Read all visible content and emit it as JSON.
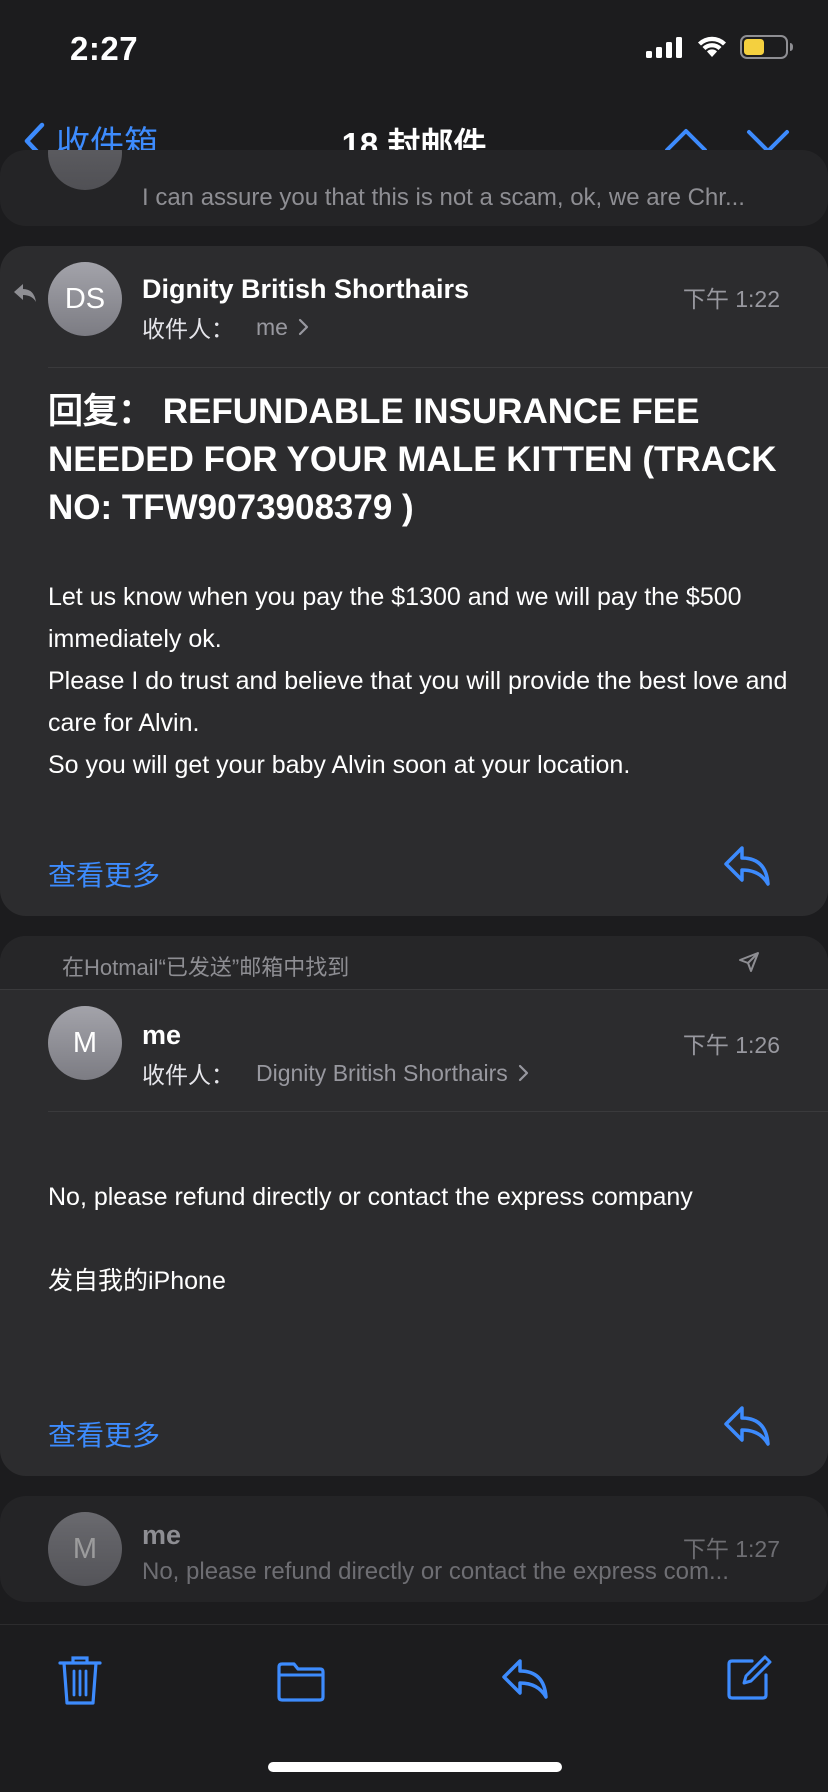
{
  "status": {
    "time": "2:27"
  },
  "nav": {
    "back_label": "收件箱",
    "title": "18 封邮件"
  },
  "top_preview": {
    "text": "I can assure you that this is not a scam, ok, we are Chr..."
  },
  "email1": {
    "initials": "DS",
    "sender": "Dignity British Shorthairs",
    "to_label": "收件人：",
    "to_value": "me",
    "time": "下午 1:22",
    "subject": "回复： REFUNDABLE INSURANCE FEE NEEDED FOR YOUR MALE KITTEN (TRACK NO: TFW9073908379 )",
    "body": [
      "Let us know when you pay the $1300 and we will pay the $500 immediately ok.",
      "Please I do trust and believe that you will provide the best love and care for Alvin.",
      "So you will get your baby Alvin soon at your location."
    ],
    "see_more": "查看更多"
  },
  "email2": {
    "found_in": "在Hotmail“已发送”邮箱中找到",
    "initials": "M",
    "sender": "me",
    "to_label": "收件人：",
    "to_value": "Dignity British Shorthairs",
    "time": "下午 1:26",
    "body": [
      "No, please refund directly or contact the express company",
      "",
      "发自我的iPhone"
    ],
    "see_more": "查看更多"
  },
  "email3": {
    "initials": "M",
    "sender": "me",
    "time": "下午 1:27",
    "preview": "No, please refund directly or contact the express com..."
  },
  "colors": {
    "accent": "#3d8bfd",
    "background": "#1c1c1e",
    "card": "#2c2c2e",
    "battery": "#f4d03f"
  },
  "icons": [
    "cellular-signal-icon",
    "wifi-icon",
    "battery-icon",
    "chevron-left-icon",
    "chevron-up-icon",
    "chevron-down-icon",
    "reply-indicator-icon",
    "chevron-right-icon",
    "reply-icon",
    "sent-plane-icon",
    "trash-icon",
    "folder-icon",
    "compose-icon"
  ]
}
